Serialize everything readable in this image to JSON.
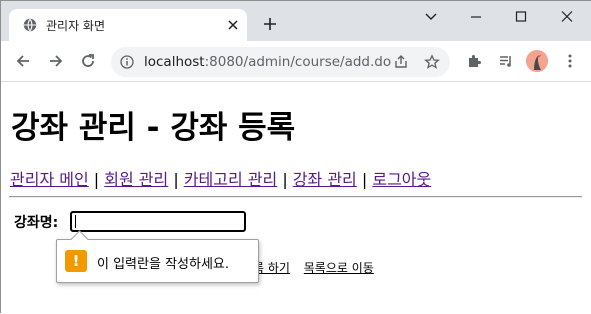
{
  "browser": {
    "tab_title": "관리자 화면",
    "url_host": "localhost",
    "url_rest": ":8080/admin/course/add.do"
  },
  "page": {
    "heading": "강좌 관리 - 강좌 등록",
    "menu": [
      "관리자 메인",
      "회원 관리",
      "카테고리 관리",
      "강좌 관리",
      "로그아웃"
    ],
    "separator": "|",
    "form": {
      "name_label": "강좌명:",
      "name_value": ""
    },
    "links": {
      "submit_partial": "록 하기",
      "back_to_list": "목록으로 이동"
    },
    "validation": {
      "message": "이 입력란을 작성하세요.",
      "icon": "warning-icon",
      "accent": "#f29900"
    }
  },
  "colors": {
    "visited_link": "#551a8b",
    "titlebar": "#dee1e6",
    "omnibox": "#f1f3f4"
  }
}
